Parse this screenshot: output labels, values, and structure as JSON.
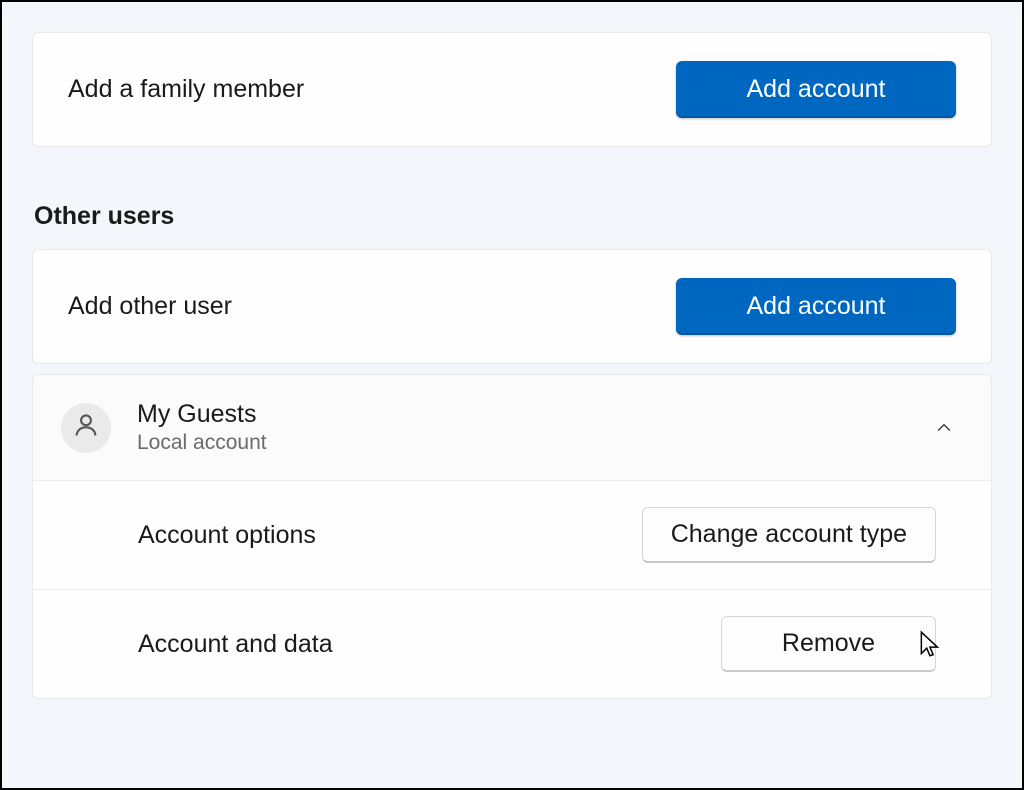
{
  "family": {
    "add_member_label": "Add a family member",
    "add_button": "Add account"
  },
  "other_users": {
    "heading": "Other users",
    "add_other_label": "Add other user",
    "add_button": "Add account",
    "user": {
      "name": "My Guests",
      "type": "Local account",
      "options_label": "Account options",
      "change_type_button": "Change account type",
      "data_label": "Account and data",
      "remove_button": "Remove"
    }
  }
}
